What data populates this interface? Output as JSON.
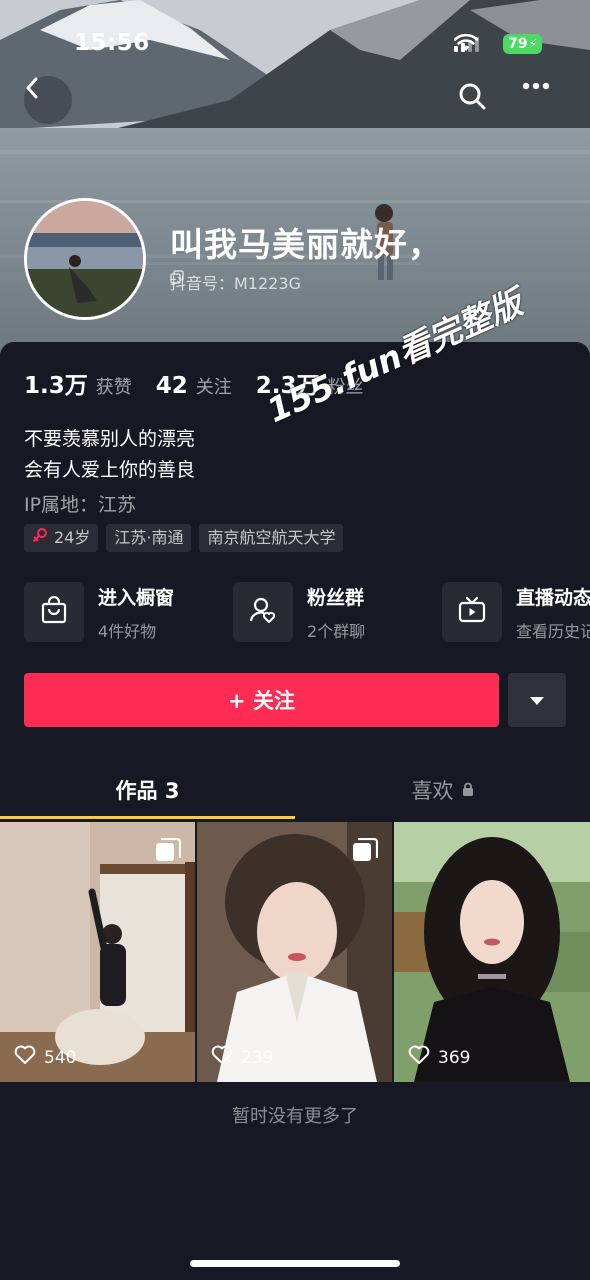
{
  "status_bar": {
    "time": "15:56",
    "battery": "79"
  },
  "profile": {
    "nickname": "叫我马美丽就好，",
    "douyin_id": "抖音号：M1223G"
  },
  "stats": [
    {
      "num": "1.3万",
      "label": "获赞"
    },
    {
      "num": "42",
      "label": "关注"
    },
    {
      "num": "2.3万",
      "label": "粉丝"
    }
  ],
  "bio": {
    "line1": "不要羡慕别人的漂亮",
    "line2": "会有人爱上你的善良"
  },
  "ip": "IP属地：江苏",
  "tags": {
    "age": "24岁",
    "location": "江苏·南通",
    "school": "南京航空航天大学"
  },
  "watermark": "155.fun看完整版",
  "features": [
    {
      "title": "进入橱窗",
      "sub": "4件好物"
    },
    {
      "title": "粉丝群",
      "sub": "2个群聊"
    },
    {
      "title": "直播动态",
      "sub": "查看历史记"
    }
  ],
  "follow_label": "+ 关注",
  "tabs": {
    "works": "作品 3",
    "likes": "喜欢"
  },
  "videos": [
    {
      "likes": "540"
    },
    {
      "likes": "239"
    },
    {
      "likes": "369"
    }
  ],
  "no_more": "暂时没有更多了",
  "colors": {
    "accent": "#fe2c55",
    "tab_underline": "#facd3b",
    "background": "#161823"
  }
}
